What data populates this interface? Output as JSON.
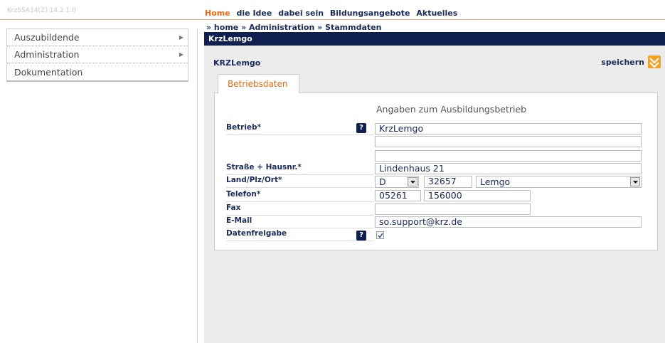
{
  "app": {
    "version": "KrzSSA14(Z) 14.2.1.0"
  },
  "topnav": {
    "items": [
      "Home",
      "die Idee",
      "dabei sein",
      "Bildungsangebote",
      "Aktuelles"
    ]
  },
  "sidebar": {
    "items": [
      {
        "label": "Auszubildende",
        "has_arrow": true
      },
      {
        "label": "Administration",
        "has_arrow": true
      },
      {
        "label": "Dokumentation",
        "has_arrow": false
      }
    ]
  },
  "breadcrumb": "» home » Administration » Stammdaten",
  "titlebar": "KrzLemgo",
  "content": {
    "subtitle": "KRZLemgo",
    "save_label": "speichern",
    "tab_label": "Betriebsdaten",
    "section_title": "Angaben zum Ausbildungsbetrieb"
  },
  "form": {
    "betrieb_label": "Betrieb*",
    "betrieb_value": "KrzLemgo",
    "betrieb_line2": "",
    "betrieb_line3": "",
    "strasse_label": "Straße + Hausnr.*",
    "strasse_value": "Lindenhaus 21",
    "landplzort_label": "Land/Plz/Ort*",
    "land_value": "D",
    "plz_value": "32657",
    "ort_value": "Lemgo",
    "telefon_label": "Telefon*",
    "telefon_vorwahl": "05261",
    "telefon_nummer": "156000",
    "fax_label": "Fax",
    "fax_value": "",
    "email_label": "E-Mail",
    "email_value": "so.support@krz.de",
    "datenfreigabe_label": "Datenfreigabe",
    "datenfreigabe_checked": true,
    "help_glyph": "?"
  },
  "colors": {
    "accent": "#e86a10",
    "navy": "#0f1f4f",
    "save_icon": "#f3a020"
  },
  "icons": {
    "save": "save-icon",
    "help": "help-icon",
    "dropdown": "chevron-down-icon",
    "arrow": "chevron-right-icon"
  }
}
